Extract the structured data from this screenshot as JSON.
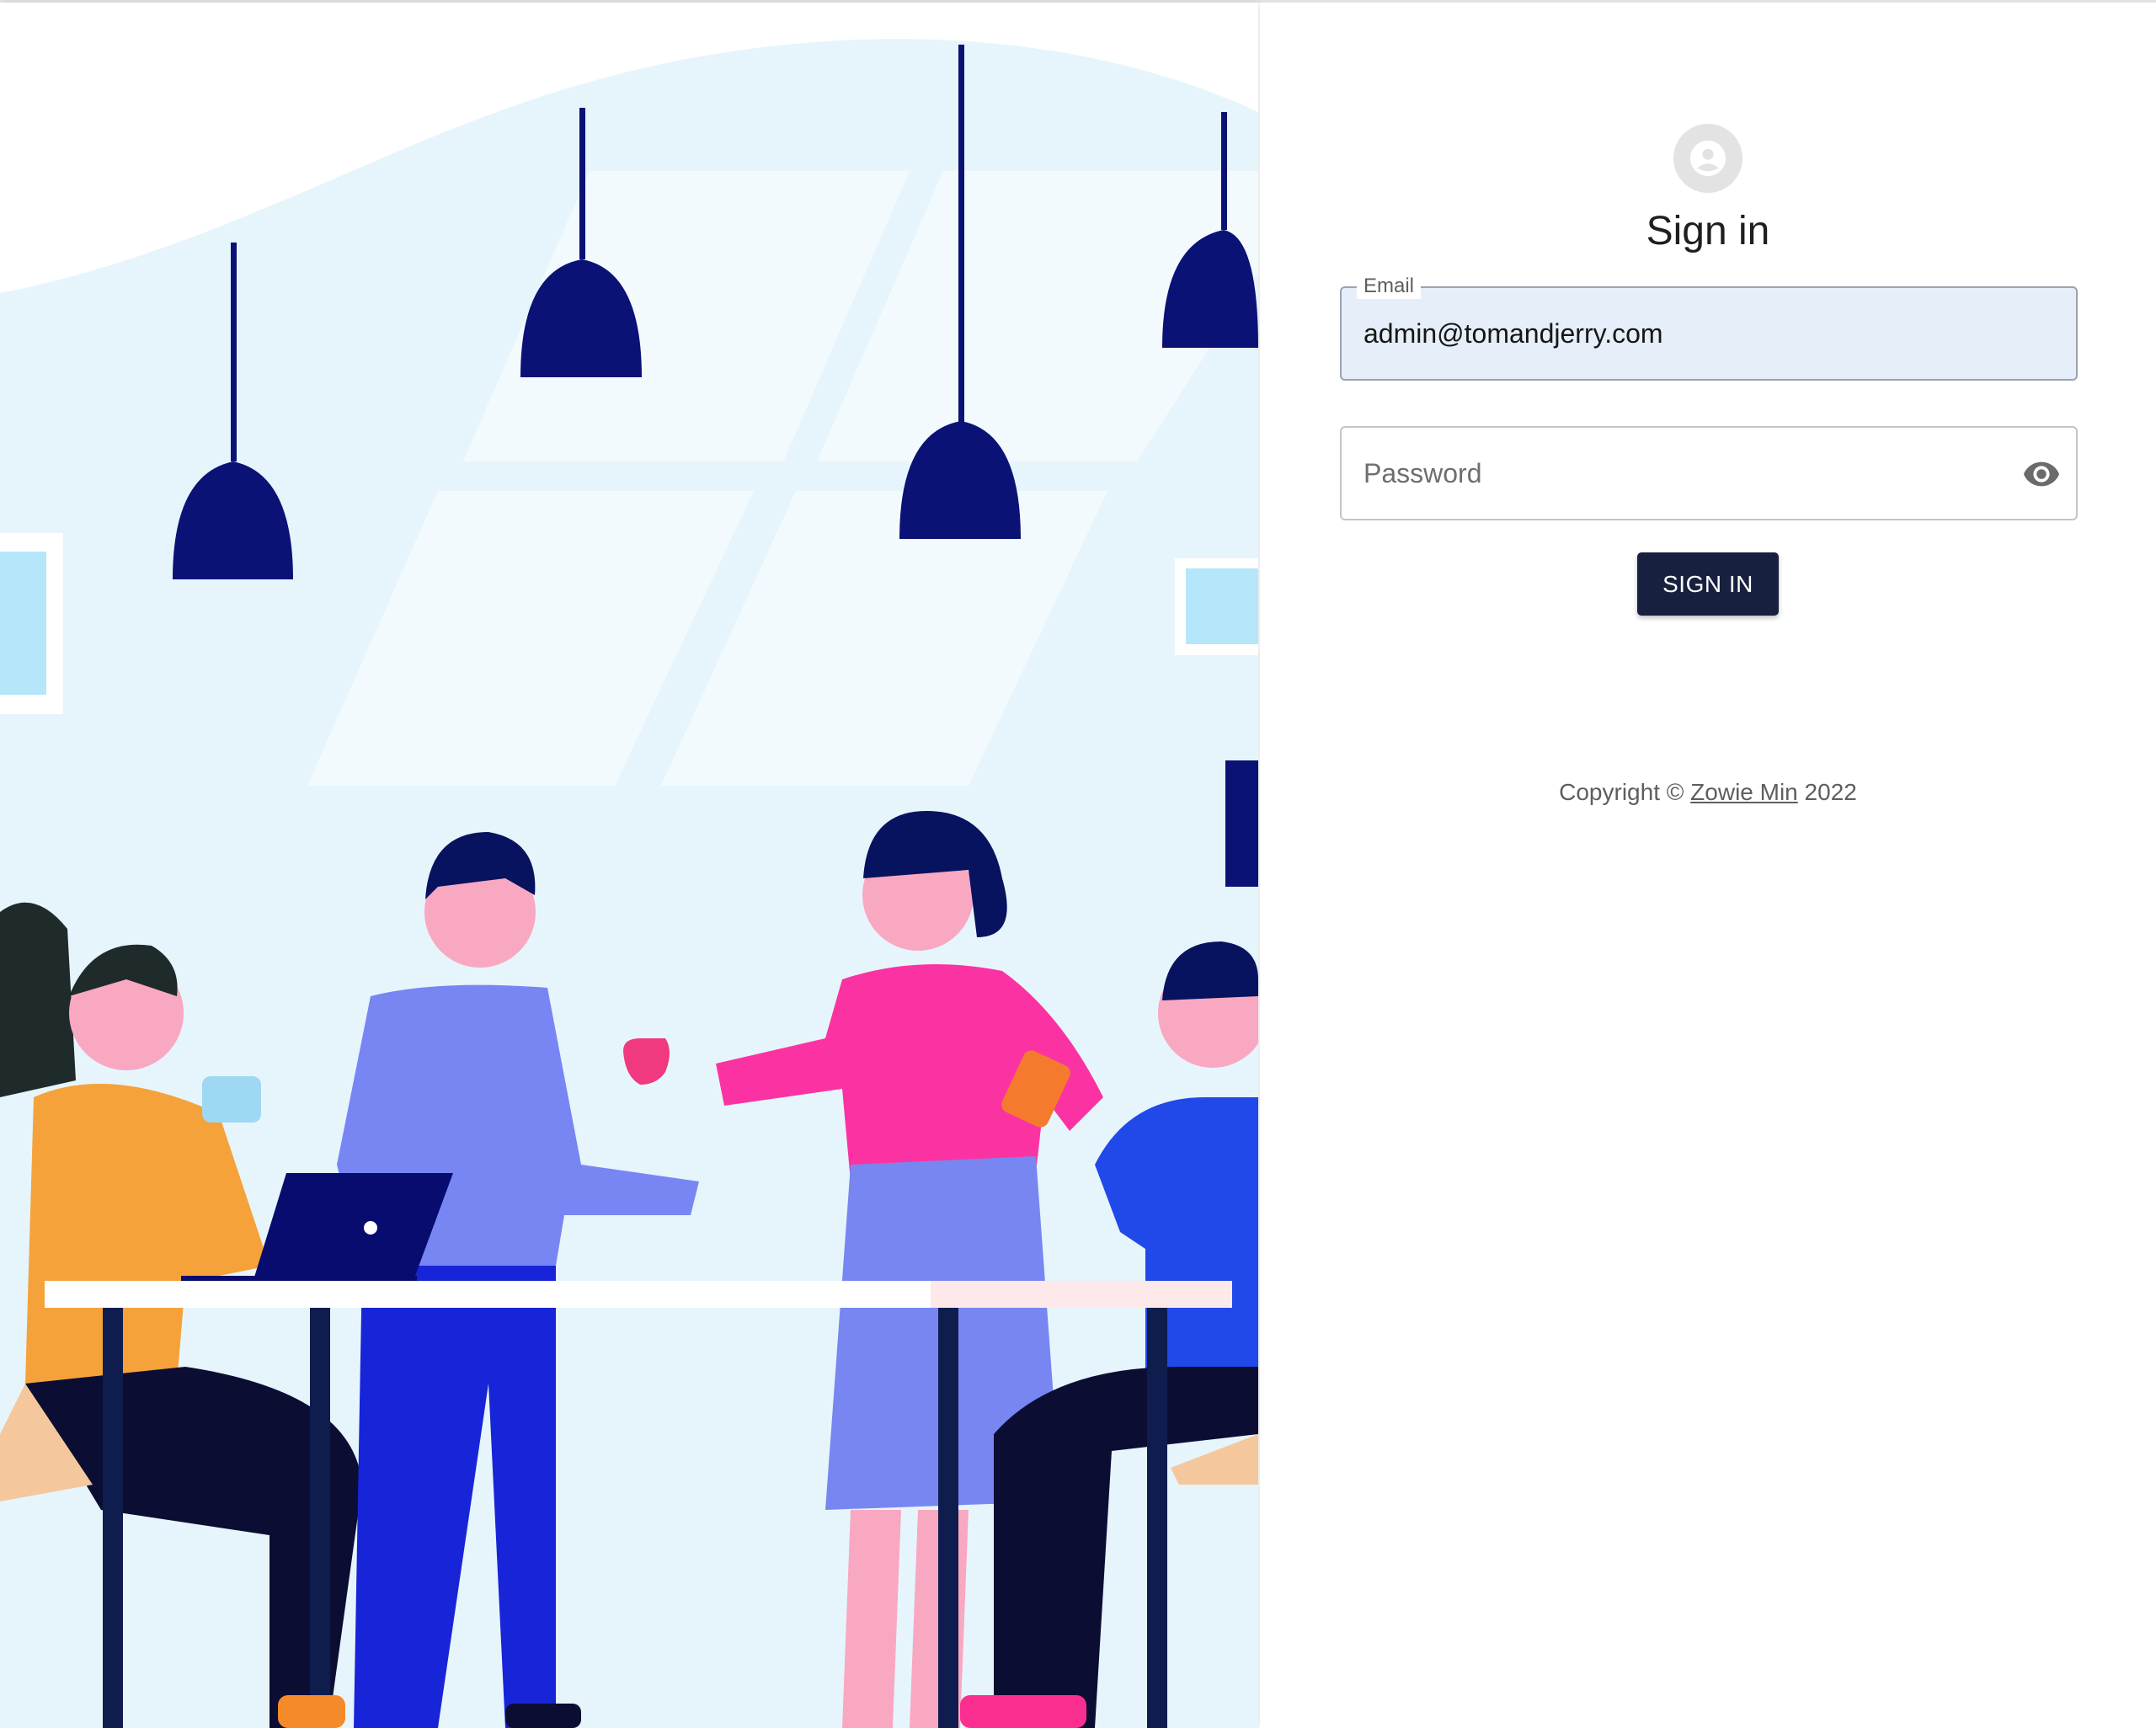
{
  "form": {
    "title": "Sign in",
    "email_label": "Email",
    "email_value": "admin@tomandjerry.com",
    "password_placeholder": "Password",
    "submit_label": "SIGN IN"
  },
  "footer": {
    "prefix": "Copyright © ",
    "author": "Zowie Min",
    "year": " 2022"
  },
  "icons": {
    "avatar": "account-circle-icon",
    "password_toggle": "eye-icon"
  },
  "colors": {
    "button_bg": "#17213f",
    "email_fill": "#e6eefa",
    "hero_bg": "#e6f5fc",
    "lamp": "#0b1275"
  }
}
